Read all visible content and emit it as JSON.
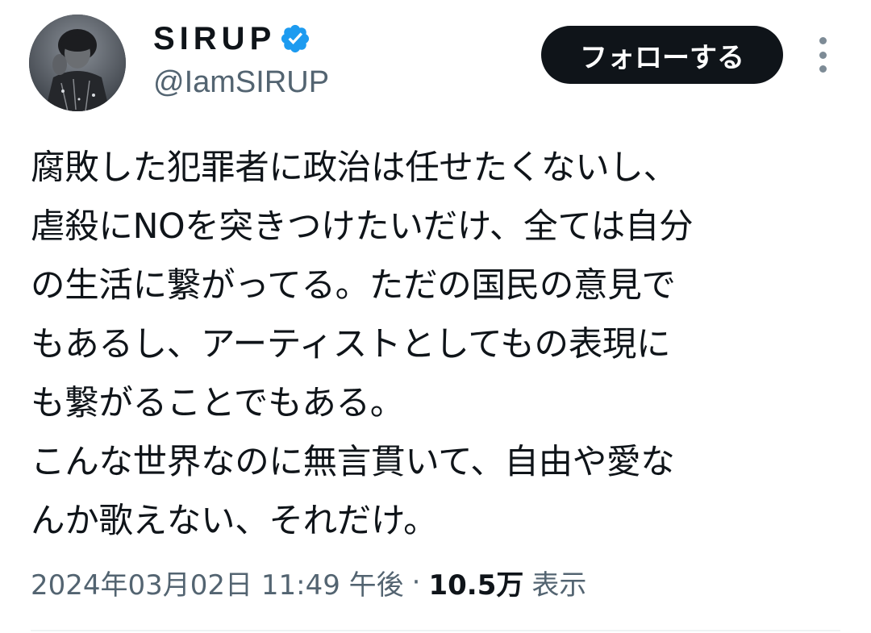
{
  "tweet": {
    "author": {
      "display_name": "SIRUP",
      "handle": "@IamSIRUP",
      "verified": true,
      "verified_icon": "verified-badge-icon",
      "verified_color": "#1d9bf0"
    },
    "follow_button_label": "フォローする",
    "more_icon": "more-vertical-icon",
    "body_lines": [
      "腐敗した犯罪者に政治は任せたくないし、",
      "虐殺にNOを突きつけたいだけ、全ては自分",
      "の生活に繋がってる。ただの国民の意見で",
      "もあるし、アーティストとしてもの表現に",
      "も繋がることでもある。",
      "こんな世界なのに無言貫いて、自由や愛な",
      "んか歌えない、それだけ。"
    ],
    "meta": {
      "timestamp": "2024年03月02日 11:49 午後",
      "separator": "·",
      "views_count": "10.5万",
      "views_label": "表示"
    }
  }
}
